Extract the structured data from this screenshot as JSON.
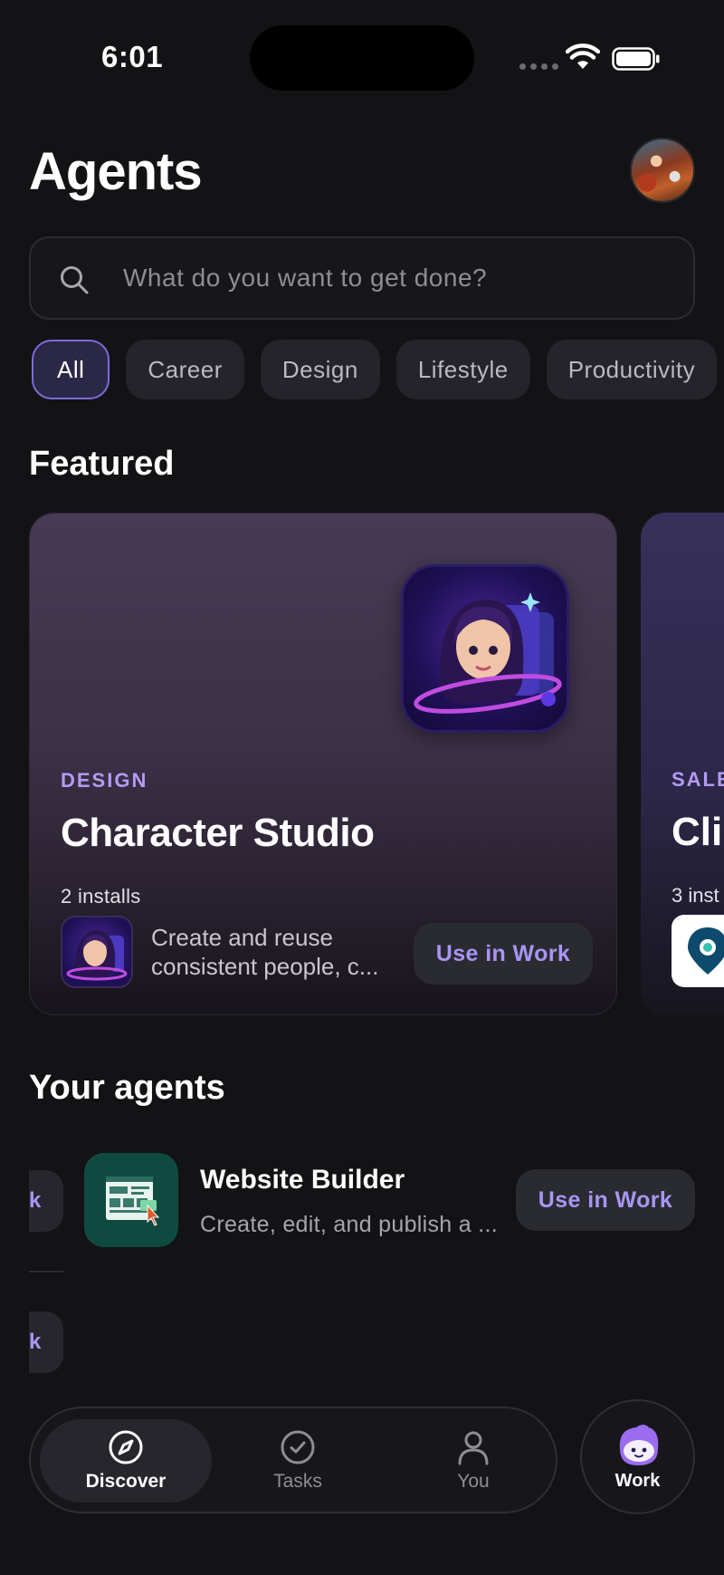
{
  "status_bar": {
    "time": "6:01"
  },
  "header": {
    "title": "Agents"
  },
  "search": {
    "placeholder": "What do you want to get done?"
  },
  "filters": [
    {
      "label": "All",
      "active": true
    },
    {
      "label": "Career"
    },
    {
      "label": "Design"
    },
    {
      "label": "Lifestyle"
    },
    {
      "label": "Productivity"
    }
  ],
  "featured": {
    "section_title": "Featured",
    "cards": [
      {
        "category": "DESIGN",
        "title": "Character Studio",
        "installs": "2 installs",
        "description": "Create and reuse consistent people, c...",
        "button": "Use in Work"
      },
      {
        "category": "SALE",
        "title": "Cli",
        "installs": "3 inst"
      }
    ]
  },
  "your_agents": {
    "section_title": "Your agents",
    "partial_button_label": "k",
    "items": [
      {
        "name": "Website Builder",
        "description": "Create, edit, and publish a ...",
        "button": "Use in Work"
      }
    ]
  },
  "bottom_nav": {
    "items": [
      {
        "label": "Discover",
        "icon": "compass-icon",
        "active": true
      },
      {
        "label": "Tasks",
        "icon": "check-circle-icon"
      },
      {
        "label": "You",
        "icon": "person-icon"
      }
    ],
    "work": {
      "label": "Work",
      "icon": "mascot-icon"
    }
  },
  "colors": {
    "accent": "#a995f5",
    "background": "#131316",
    "active_chip_border": "#7b6cd9"
  }
}
